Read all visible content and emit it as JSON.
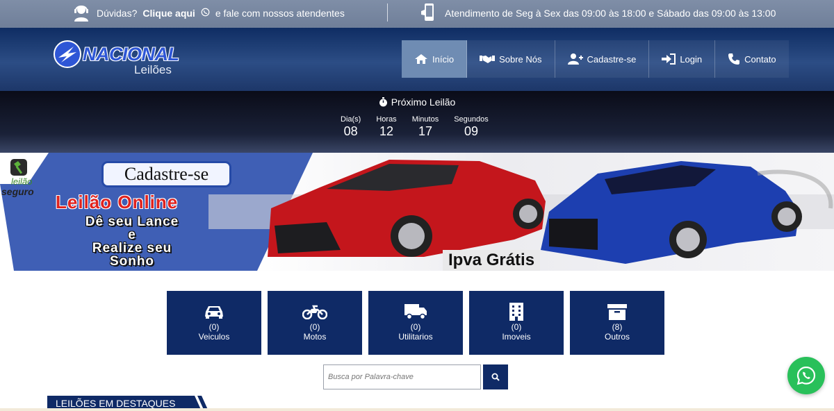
{
  "topbar": {
    "help_prefix": "Dúvidas?",
    "help_link": "Clique aqui",
    "help_suffix": "e fale com nossos atendentes",
    "hours": "Atendimento de Seg à Sex das 09:00 às 18:00 e Sábado das 09:00 às 13:00"
  },
  "header": {
    "logo_name": "NACIONAL",
    "logo_sub": "Leilões",
    "nav": [
      {
        "label": "Início",
        "icon": "home-icon"
      },
      {
        "label": "Sobre Nós",
        "icon": "handshake-icon"
      },
      {
        "label": "Cadastre-se",
        "icon": "user-plus-icon"
      },
      {
        "label": "Login",
        "icon": "sign-in-icon"
      },
      {
        "label": "Contato",
        "icon": "phone-icon"
      }
    ]
  },
  "countdown": {
    "title": "Próximo Leilão",
    "units": [
      {
        "label": "Dia(s)",
        "value": "08"
      },
      {
        "label": "Horas",
        "value": "12"
      },
      {
        "label": "Minutos",
        "value": "17"
      },
      {
        "label": "Segundos",
        "value": "09"
      }
    ]
  },
  "banner": {
    "badge_line1": "leilão",
    "badge_line2": "seguro",
    "cadastre": "Cadastre-se",
    "headline": "Leilão Online",
    "slogan": [
      "Dê seu Lance",
      "e",
      "Realize seu",
      "Sonho"
    ],
    "ipva": "Ipva Grátis"
  },
  "categories": [
    {
      "count": "(0)",
      "label": "Veiculos",
      "icon": "car-icon"
    },
    {
      "count": "(0)",
      "label": "Motos",
      "icon": "motorcycle-icon"
    },
    {
      "count": "(0)",
      "label": "Utilitarios",
      "icon": "truck-icon"
    },
    {
      "count": "(0)",
      "label": "Imoveis",
      "icon": "building-icon"
    },
    {
      "count": "(8)",
      "label": "Outros",
      "icon": "archive-icon"
    }
  ],
  "search": {
    "placeholder": "Busca por Palavra-chave"
  },
  "section": {
    "title": "LEILÕES EM DESTAQUES"
  },
  "colors": {
    "brand_navy": "#0f2a66",
    "nav_active": "#6f8cb3",
    "accent_red": "#e0231f",
    "whatsapp": "#29c05a"
  }
}
